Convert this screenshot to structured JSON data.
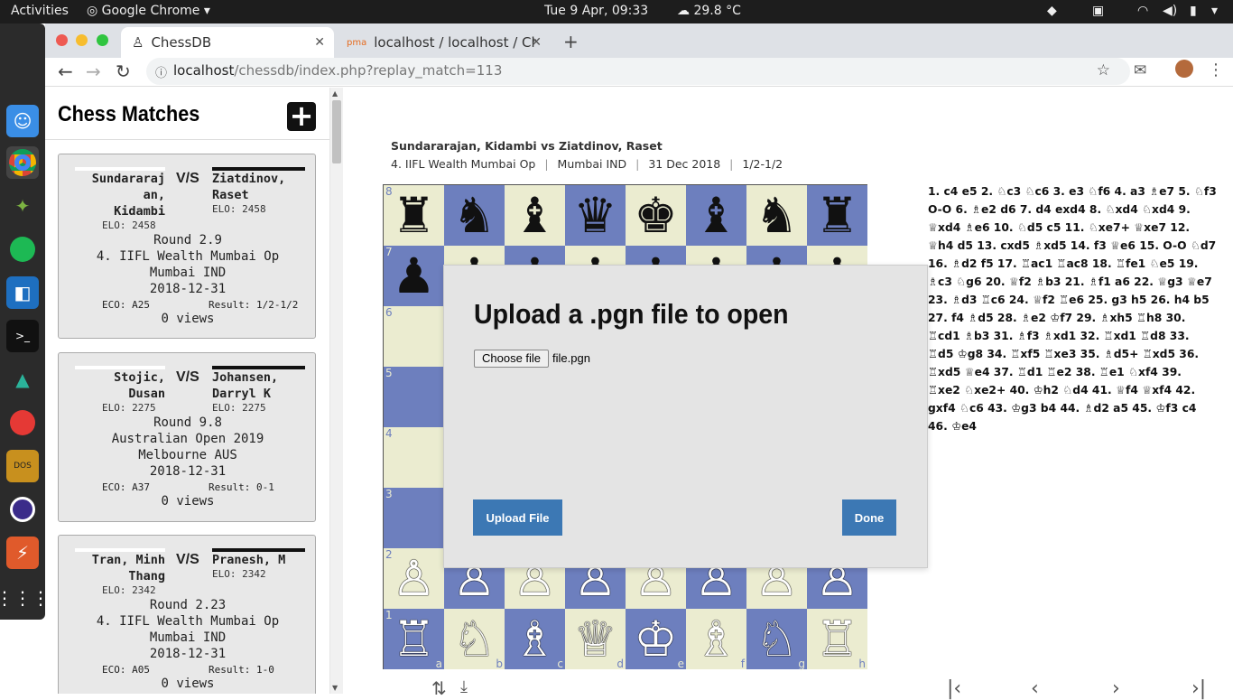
{
  "topbar": {
    "activities": "Activities",
    "app": "Google Chrome",
    "clock": "Tue  9 Apr, 09:33",
    "weather": "29.8 °C"
  },
  "browser": {
    "tabs": [
      {
        "title": "ChessDB"
      },
      {
        "title": "localhost / localhost / Che"
      }
    ],
    "url_host": "localhost",
    "url_path": "/chessdb/index.php?replay_match=113"
  },
  "sidebar": {
    "title": "Chess Matches",
    "add_label": "+"
  },
  "matches": [
    {
      "white": "Sundararaj\nan,\nKidambi",
      "black": "Ziatdinov,\nRaset",
      "white_elo": "ELO: 2458",
      "black_elo": "ELO: 2458",
      "vs": "V/S",
      "round": "Round 2.9",
      "event": "4. IIFL Wealth Mumbai Op",
      "site": "Mumbai IND",
      "date": "2018-12-31",
      "eco": "ECO: A25",
      "result": "Result: 1/2-1/2",
      "views": "0 views"
    },
    {
      "white": "Stojic,\nDusan",
      "black": "Johansen,\nDarryl K",
      "white_elo": "ELO: 2275",
      "black_elo": "ELO: 2275",
      "vs": "V/S",
      "round": "Round 9.8",
      "event": "Australian Open 2019",
      "site": "Melbourne AUS",
      "date": "2018-12-31",
      "eco": "ECO: A37",
      "result": "Result: 0-1",
      "views": "0 views"
    },
    {
      "white": "Tran, Minh\nThang",
      "black": "Pranesh, M",
      "white_elo": "ELO: 2342",
      "black_elo": "ELO: 2342",
      "vs": "V/S",
      "round": "Round 2.23",
      "event": "4. IIFL Wealth Mumbai Op",
      "site": "Mumbai IND",
      "date": "2018-12-31",
      "eco": "ECO: A05",
      "result": "Result: 1-0",
      "views": "0 views"
    }
  ],
  "game": {
    "title": "Sundararajan, Kidambi vs Ziatdinov, Raset",
    "meta": [
      "4. IIFL Wealth Mumbai Op",
      "Mumbai IND",
      "31 Dec 2018",
      "1/2-1/2"
    ],
    "moves": "1. c4  e5  2. ♘c3  ♘c6  3. e3  ♘f6  4. a3  ♗e7  5. ♘f3  O-O  6. ♗e2  d6  7. d4  exd4  8. ♘xd4  ♘xd4  9. ♕xd4  ♗e6  10. ♘d5  c5  11. ♘xe7+  ♕xe7  12. ♕h4  d5  13. cxd5  ♗xd5  14. f3  ♕e6  15. O-O  ♘d7  16. ♗d2  f5  17. ♖ac1  ♖ac8  18. ♖fe1  ♘e5  19. ♗c3  ♘g6  20. ♕f2  ♗b3  21. ♗f1  a6  22. ♕g3  ♕e7  23. ♗d3  ♖c6  24. ♕f2  ♖e6  25. g3  h5  26. h4  b5  27. f4  ♗d5  28. ♗e2  ♔f7  29. ♗xh5  ♖h8  30. ♖cd1  ♗b3  31. ♗f3  ♗xd1  32. ♖xd1  ♖d8  33. ♖d5  ♔g8  34. ♖xf5  ♖xe3  35. ♗d5+  ♖xd5  36. ♖xd5  ♕e4  37. ♖d1  ♖e2  38. ♖e1  ♘xf4  39. ♖xe2  ♘xe2+  40. ♔h2  ♘d4  41. ♕f4  ♕xf4  42. gxf4  ♘c6  43. ♔g3  b4  44. ♗d2  a5  45. ♔f3  c4  46. ♔e4"
  },
  "board": {
    "rank8": [
      "♜",
      "♞",
      "♝",
      "♛",
      "♚",
      "♝",
      "♞",
      "♜"
    ],
    "rank7": [
      "♟",
      "♟",
      "♟",
      "♟",
      "♟",
      "♟",
      "♟",
      "♟"
    ],
    "rank2": [
      "♙",
      "♙",
      "♙",
      "♙",
      "♙",
      "♙",
      "♙",
      "♙"
    ],
    "rank1": [
      "♖",
      "♘",
      "♗",
      "♕",
      "♔",
      "♗",
      "♘",
      "♖"
    ],
    "ranks": [
      "8",
      "7",
      "6",
      "5",
      "4",
      "3",
      "2",
      "1"
    ],
    "files": [
      "a",
      "b",
      "c",
      "d",
      "e",
      "f",
      "g",
      "h"
    ],
    "dark": "#6d7fbe",
    "light": "#ebecd0"
  },
  "modal": {
    "title": "Upload a .pgn file to open",
    "choose": "Choose file",
    "filename": "file.pgn",
    "upload": "Upload File",
    "done": "Done"
  }
}
